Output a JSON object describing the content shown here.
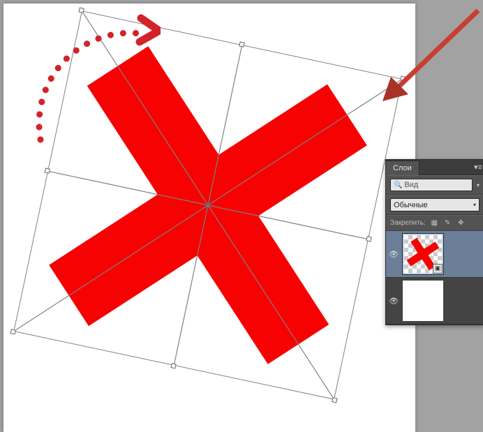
{
  "annotations": {
    "rotation_color": "#d2232a",
    "pointer_color": "#c0392b"
  },
  "canvas": {
    "shape": "x-cross",
    "shape_color": "#f60202",
    "transform_rotation_deg": 12
  },
  "panel": {
    "tab_label": "Слои",
    "menu_icon": "panel-menu-icon",
    "search_placeholder": "Вид",
    "blend_mode": "Обычные",
    "lock_label": "Закрепить:",
    "lock_icons": [
      "pixels",
      "brush",
      "move",
      "all"
    ]
  },
  "layers": [
    {
      "visible": true,
      "active": true,
      "kind": "smart-object",
      "content": "red-x"
    },
    {
      "visible": true,
      "active": false,
      "kind": "background",
      "content": "white"
    }
  ]
}
